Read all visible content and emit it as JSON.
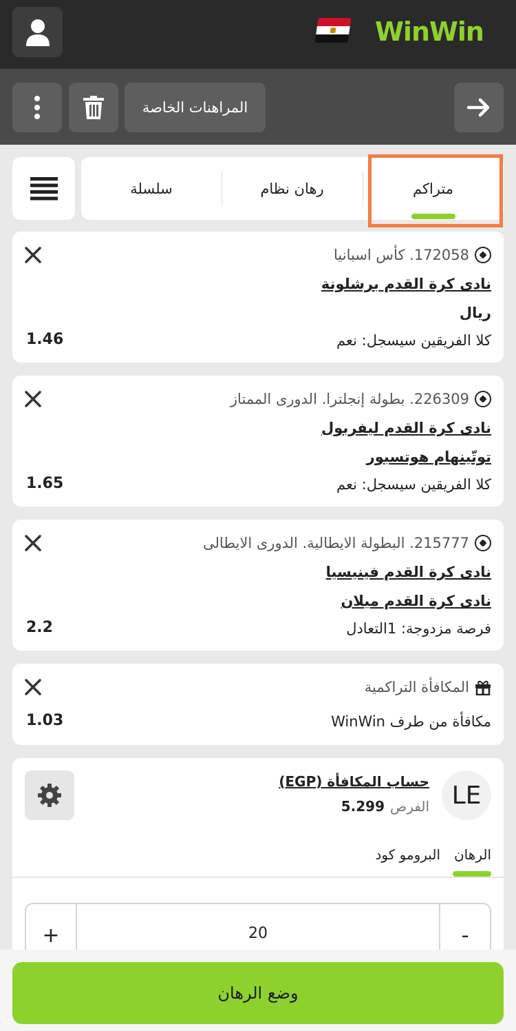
{
  "header": {
    "logo": "WinWin",
    "flag": "egypt-flag-icon"
  },
  "toolbar": {
    "private_bets": "المراهنات الخاصة"
  },
  "tabs": [
    {
      "label": "سلسلة"
    },
    {
      "label": "رهان نظام"
    },
    {
      "label": "متراكم"
    }
  ],
  "bets": [
    {
      "league": "172058. كأس اسبانيا",
      "team1": "نادى كرة القدم برشلونة",
      "team2": "ريال",
      "team2_underlined": false,
      "outcome": "كلا الفريقين سيسجل: نعم",
      "odd": "1.46"
    },
    {
      "league": "226309. بطولة إنجلترا. الدورى الممتاز",
      "team1": "نادى كرة القدم ليفربول",
      "team2": "توتّينهام هوتسبور",
      "team2_underlined": true,
      "outcome": "كلا الفريقين سيسجل: نعم",
      "odd": "1.65"
    },
    {
      "league": "215777. البطولة الايطالية. الدورى الايطالى",
      "team1": "نادى كرة القدم فينيسيا",
      "team2": "نادى كرة القدم ميلان",
      "team2_underlined": true,
      "outcome": "فرصة مزدوجة: 1التعادل",
      "odd": "2.2"
    }
  ],
  "bonus": {
    "title": "المكافأة التراكمية",
    "text": "مكافأة من طرف WinWin",
    "odd": "1.03"
  },
  "account": {
    "initials": "LE",
    "title": "حساب المكافأة (EGP)",
    "balance_label": "الفرص",
    "balance": "5.299"
  },
  "stake_tabs": {
    "bet": "الرهان",
    "promo": "البرومو كود"
  },
  "stepper": {
    "plus": "+",
    "minus": "-",
    "value": "20"
  },
  "place_bet": "وضع الرهان",
  "colors": {
    "accent": "#8dd22c",
    "highlight": "#f47c45",
    "header": "#2a2a2a",
    "toolbar": "#4a4a4a"
  }
}
